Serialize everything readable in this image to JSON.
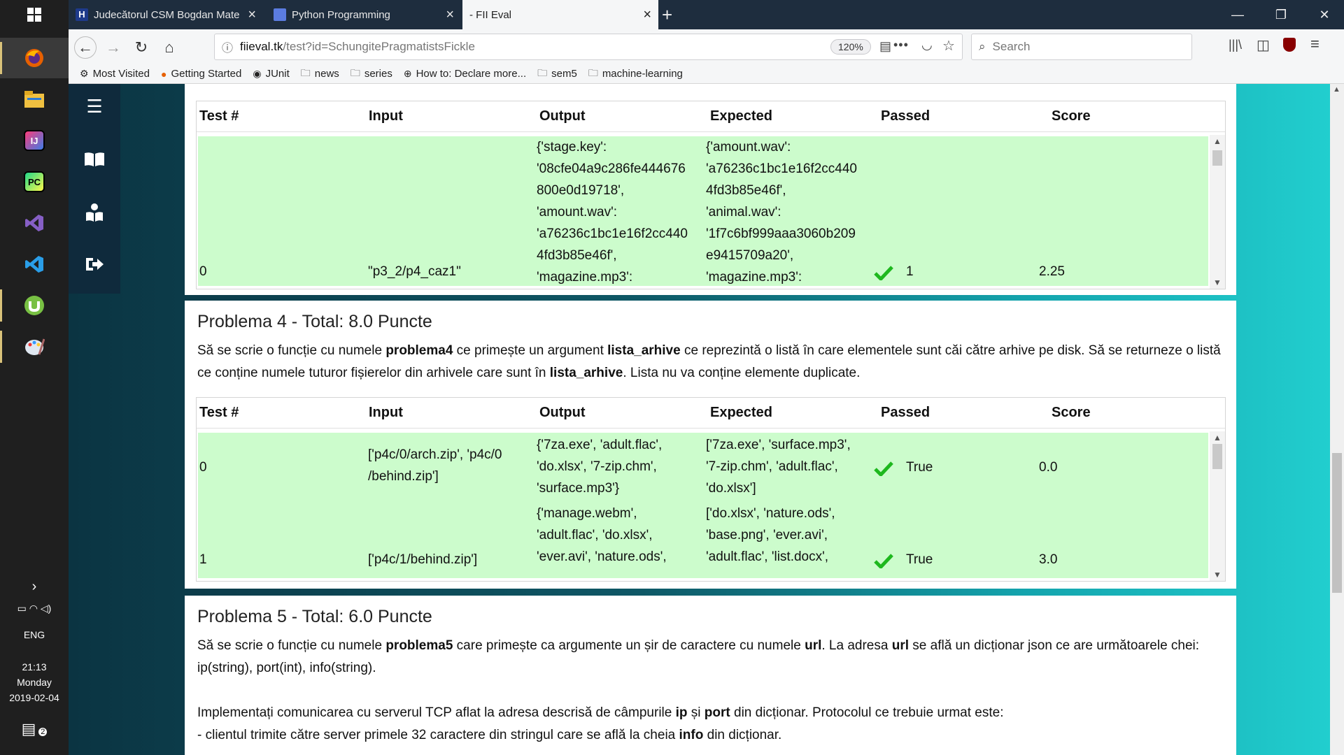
{
  "taskbar": {
    "apps": [
      {
        "name": "windows-start-icon"
      },
      {
        "name": "firefox-icon"
      },
      {
        "name": "file-explorer-icon"
      },
      {
        "name": "intellij-icon"
      },
      {
        "name": "pycharm-icon"
      },
      {
        "name": "visual-studio-icon"
      },
      {
        "name": "vscode-icon"
      },
      {
        "name": "utorrent-icon"
      },
      {
        "name": "paint-icon"
      }
    ],
    "tray": {
      "lang": "ENG",
      "time": "21:13",
      "day": "Monday",
      "date": "2019-02-04",
      "notif_count": "2"
    }
  },
  "browser": {
    "tabs": [
      {
        "label": "Judecătorul CSM Bogdan Mate",
        "icon": "judge-favicon-icon"
      },
      {
        "label": "Python Programming",
        "icon": "python-favicon-icon"
      },
      {
        "label": "- FII Eval",
        "icon": "fii-eval-favicon-icon"
      }
    ],
    "url": {
      "host": "fiieval.tk",
      "path": "/test?id=SchungitePragmatistsFickle"
    },
    "zoom": "120%",
    "search_placeholder": "Search",
    "bookmarks": [
      "Most Visited",
      "Getting Started",
      "JUnit",
      "news",
      "series",
      "How to: Declare more...",
      "sem5",
      "machine-learning"
    ]
  },
  "page": {
    "columns": {
      "test": "Test #",
      "input": "Input",
      "output": "Output",
      "expected": "Expected",
      "passed": "Passed",
      "score": "Score"
    },
    "problem3_rows": [
      {
        "test": "0",
        "input": "\"p3_2/p4_caz1\"",
        "output_lines": [
          "{'stage.key':",
          "'08cfe04a9c286fe444676",
          "800e0d19718',",
          "'amount.wav':",
          "'a76236c1bc1e16f2cc440",
          "4fd3b85e46f',",
          "'magazine.mp3':"
        ],
        "expected_lines": [
          "{'amount.wav':",
          "'a76236c1bc1e16f2cc440",
          "4fd3b85e46f',",
          "'animal.wav':",
          "'1f7c6bf999aaa3060b209",
          "e9415709a20',",
          "'magazine.mp3':"
        ],
        "passed": "1",
        "score": "2.25"
      }
    ],
    "problem4": {
      "title": "Problema 4 - Total: 8.0 Puncte",
      "desc_1": "Să se scrie o funcție cu numele ",
      "desc_b1": "problema4",
      "desc_2": " ce primește un argument ",
      "desc_b2": "lista_arhive",
      "desc_3": " ce reprezintă o listă în care elementele sunt căi către arhive pe disk. Să se returneze o listă ce conține numele tuturor fișierelor din arhivele care sunt în ",
      "desc_b3": "lista_arhive",
      "desc_4": ". Lista nu va conține elemente duplicate.",
      "rows": [
        {
          "test": "0",
          "input_lines": [
            "['p4c/0/arch.zip', 'p4c/0",
            "/behind.zip']"
          ],
          "output_lines": [
            "{'7za.exe', 'adult.flac',",
            "'do.xlsx', '7-zip.chm',",
            "'surface.mp3'}"
          ],
          "expected_lines": [
            "['7za.exe', 'surface.mp3',",
            "'7-zip.chm', 'adult.flac',",
            "'do.xlsx']"
          ],
          "passed": "True",
          "score": "0.0"
        },
        {
          "test": "1",
          "input_lines": [
            "['p4c/1/behind.zip']"
          ],
          "output_lines": [
            "{'manage.webm',",
            "'adult.flac', 'do.xlsx',",
            "'ever.avi', 'nature.ods',"
          ],
          "expected_lines": [
            "['do.xlsx', 'nature.ods',",
            "'base.png', 'ever.avi',",
            "'adult.flac', 'list.docx',"
          ],
          "passed": "True",
          "score": "3.0"
        }
      ]
    },
    "problem5": {
      "title": "Problema 5 - Total: 6.0 Puncte",
      "p1_1": "Să se scrie o funcție cu numele ",
      "p1_b1": "problema5",
      "p1_2": " care primește ca argumente un șir de caractere cu numele ",
      "p1_b2": "url",
      "p1_3": ". La adresa ",
      "p1_b3": "url",
      "p1_4": " se află un dicționar json ce are următoarele chei: ip(string), port(int), info(string).",
      "p2_1": "Implementați comunicarea cu serverul TCP aflat la adresa descrisă de câmpurile ",
      "p2_b1": "ip",
      "p2_2": " și ",
      "p2_b2": "port",
      "p2_3": " din dicționar. Protocolul ce trebuie urmat este:",
      "p3_1": "- clientul trimite către server primele 32 caractere din stringul care se află la cheia ",
      "p3_b1": "info",
      "p3_2": " din dicționar."
    }
  },
  "colors": {
    "row_pass": "#ccfccc",
    "check": "#1eb81e"
  }
}
